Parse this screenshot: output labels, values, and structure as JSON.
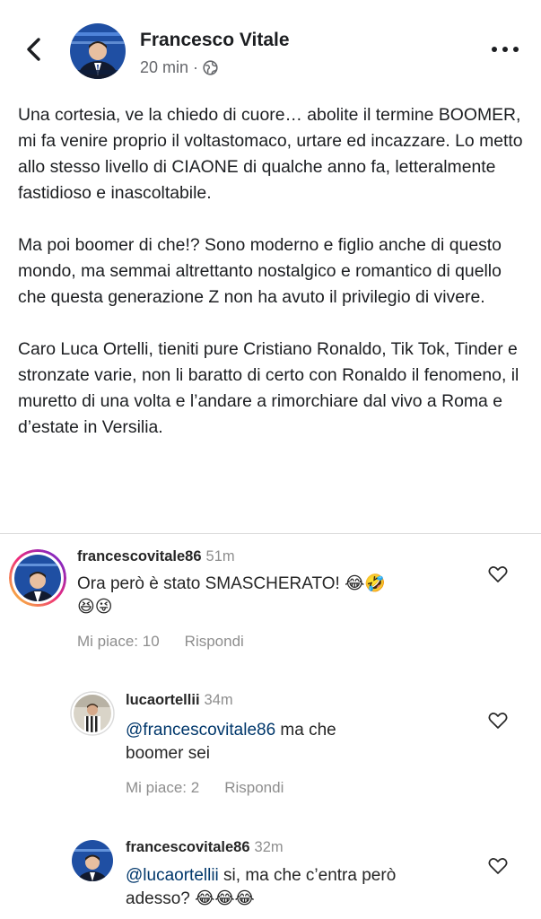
{
  "post": {
    "author": "Francesco Vitale",
    "time": "20 min",
    "separator": "·",
    "paragraphs": [
      "Una cortesia, ve la chiedo di cuore… abolite il termine BOOMER, mi fa venire proprio il voltastomaco, urtare ed incazzare. Lo metto allo stesso livello di CIAONE di qualche anno fa, letteralmente fastidioso e inascoltabile.",
      "Ma poi boomer di che!? Sono moderno e figlio anche di questo mondo, ma semmai altrettanto nostalgico e romantico di quello che questa generazione Z non ha avuto il privilegio di vivere.",
      "Caro Luca Ortelli, tieniti pure Cristiano Ronaldo, Tik Tok, Tinder e stronzate varie, non li baratto di certo con Ronaldo il fenomeno, il muretto di una volta e l’andare a rimorchiare dal vivo a Roma e d’estate in Versilia."
    ]
  },
  "comments": [
    {
      "username": "francescovitale86",
      "time": "51m",
      "text_line1": "Ora però è stato SMASCHERATO! 😂🤣",
      "text_line2": "😆😜",
      "likes": "Mi piace: 10",
      "reply": "Rispondi"
    },
    {
      "username": "lucaortellii",
      "time": "34m",
      "mention": "@francescovitale86",
      "text_rest": " ma che",
      "text_line2": "boomer sei",
      "likes": "Mi piace: 2",
      "reply": "Rispondi"
    },
    {
      "username": "francescovitale86",
      "time": "32m",
      "mention": "@lucaortellii",
      "text_rest": " si, ma che c’entra però",
      "text_line2": "adesso? 😂😂😂"
    }
  ],
  "icons": {
    "back": "chevron-left-icon",
    "globe": "globe-icon",
    "more": "more-horizontal-icon",
    "heart": "heart-outline-icon"
  },
  "colors": {
    "text": "#1c1e21",
    "secondary": "#65676b",
    "mention": "#00376b",
    "story_ring_start": "#f9ce34",
    "story_ring_end": "#c13584"
  }
}
